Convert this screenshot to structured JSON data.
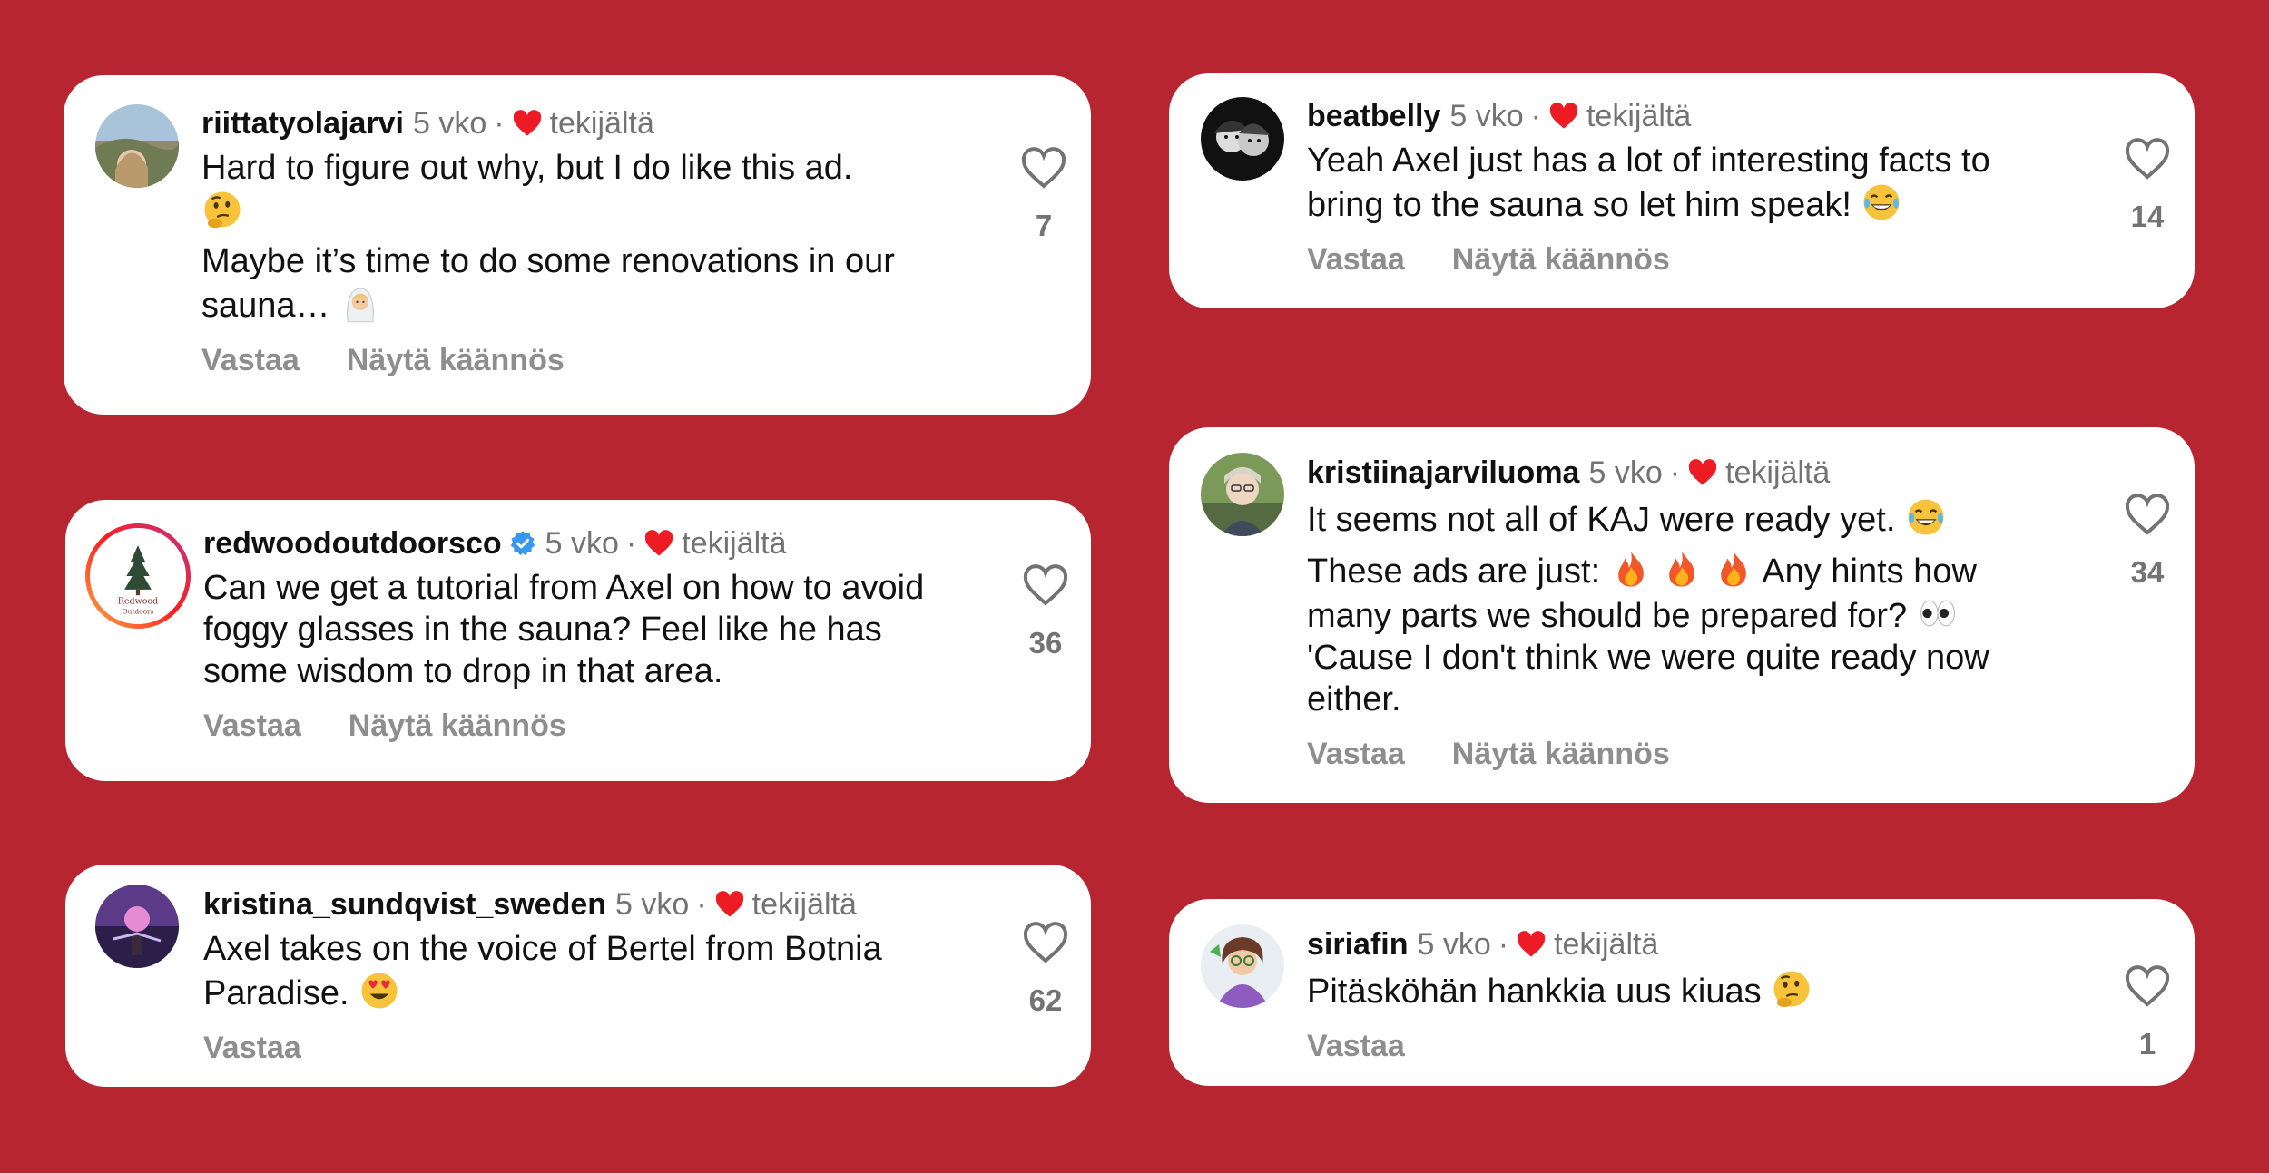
{
  "colors": {
    "background": "#b72530",
    "card": "#ffffff",
    "heart": "#ed1c24",
    "verified": "#3897f0"
  },
  "comments": [
    {
      "username": "riittatyolajarvi",
      "time": "5 vko",
      "dot": "·",
      "liked_by": "tekijältä",
      "lines": [
        "Hard to figure out why, but I do like this ad.",
        "Maybe it’s time to do some renovations in our sauna…"
      ],
      "emojis": [
        "thinking-face",
        "woman-in-veil"
      ],
      "reply": "Vastaa",
      "translate": "Näytä käännös",
      "likes": "7"
    },
    {
      "username": "redwoodoutdoorsco",
      "verified": true,
      "time": "5 vko",
      "dot": "·",
      "liked_by": "tekijältä",
      "lines": [
        "Can we get a tutorial from Axel on how to avoid foggy glasses in the sauna? Feel like he has some wisdom to drop in that area."
      ],
      "reply": "Vastaa",
      "translate": "Näytä käännös",
      "likes": "36",
      "avatar_text": [
        "Redwood",
        "Outdoors"
      ]
    },
    {
      "username": "kristina_sundqvist_sweden",
      "time": "5 vko",
      "dot": "·",
      "liked_by": "tekijältä",
      "lines": [
        "Axel takes on the voice of Bertel from Botnia Paradise."
      ],
      "emojis": [
        "heart-eyes"
      ],
      "reply": "Vastaa",
      "likes": "62"
    },
    {
      "username": "beatbelly",
      "time": "5 vko",
      "dot": "·",
      "liked_by": "tekijältä",
      "lines": [
        "Yeah Axel just has a lot of interesting facts to bring to the sauna so let him speak!"
      ],
      "emojis": [
        "tears-of-joy"
      ],
      "reply": "Vastaa",
      "translate": "Näytä käännös",
      "likes": "14"
    },
    {
      "username": "kristiinajarviluoma",
      "time": "5 vko",
      "dot": "·",
      "liked_by": "tekijältä",
      "lines": [
        "It seems not all of KAJ were ready yet.",
        "These ads are just:",
        "Any hints how many parts we should be prepared for?",
        "'Cause I don't think we were quite ready now either."
      ],
      "emojis": [
        "tears-of-joy",
        "fire",
        "fire",
        "fire",
        "eyes"
      ],
      "reply": "Vastaa",
      "translate": "Näytä käännös",
      "likes": "34"
    },
    {
      "username": "siriafin",
      "time": "5 vko",
      "dot": "·",
      "liked_by": "tekijältä",
      "lines": [
        "Pitäsköhän hankkia uus kiuas"
      ],
      "emojis": [
        "thinking-face"
      ],
      "reply": "Vastaa",
      "likes": "1"
    }
  ]
}
